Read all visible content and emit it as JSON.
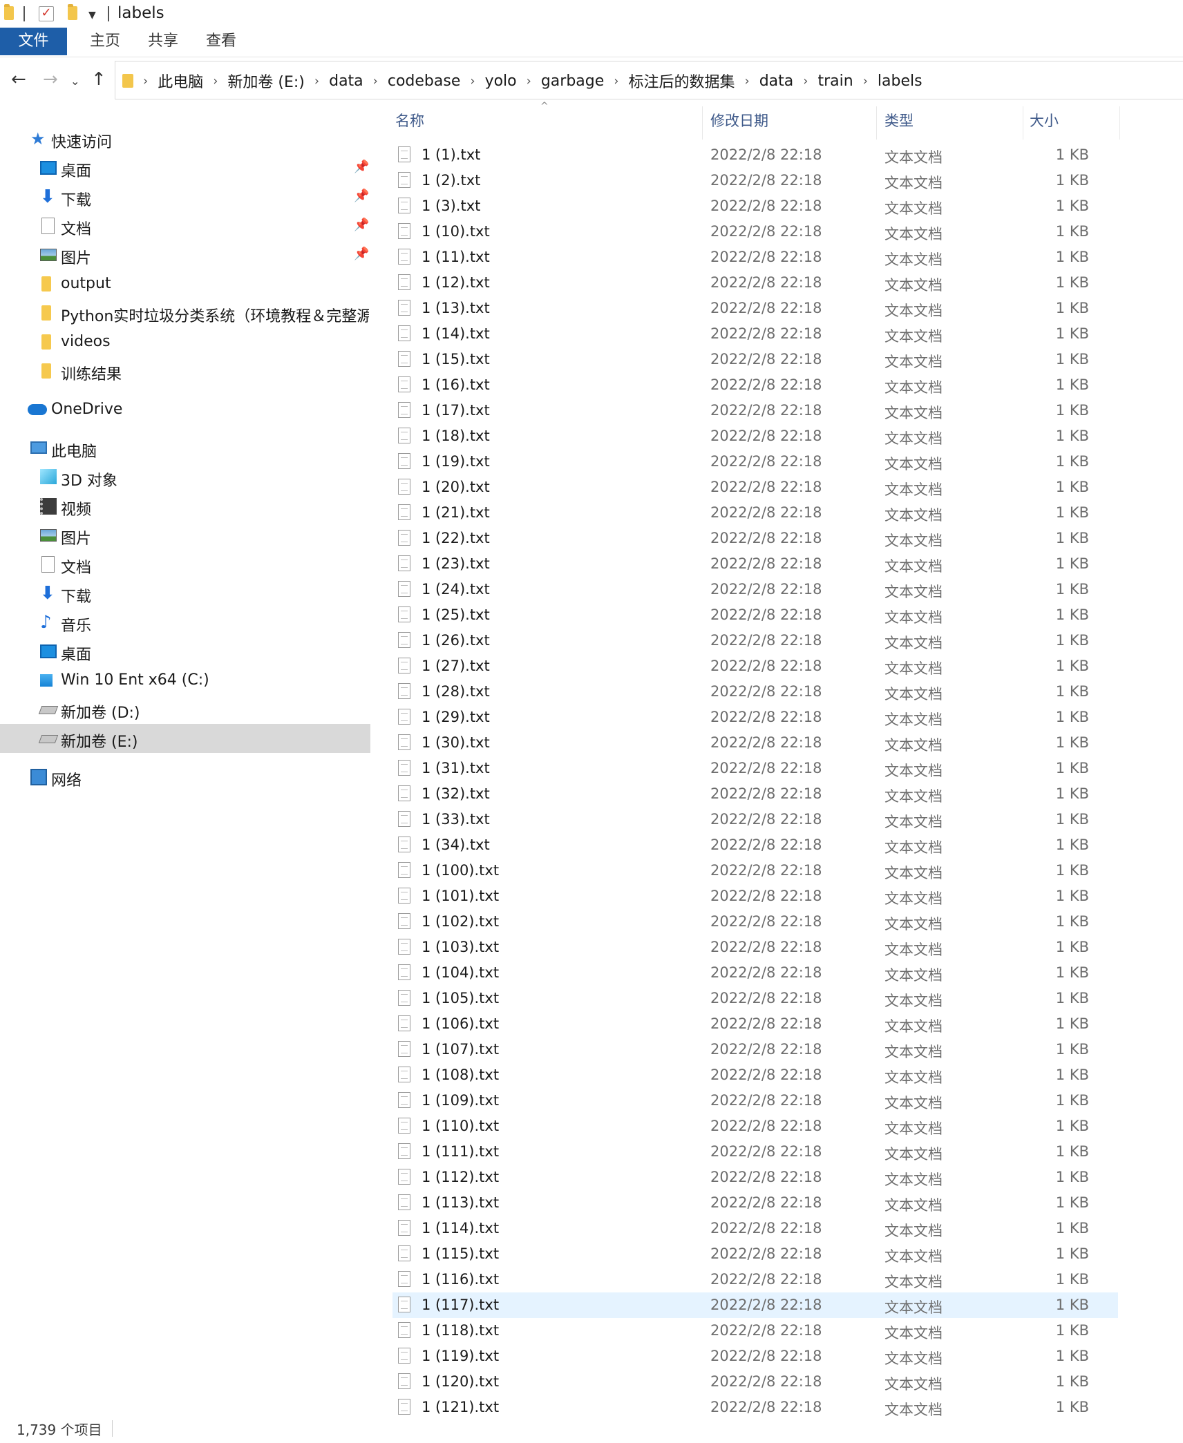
{
  "window": {
    "title": "labels"
  },
  "ribbon": {
    "tabs": [
      "文件",
      "主页",
      "共享",
      "查看"
    ]
  },
  "address": {
    "crumbs": [
      "此电脑",
      "新加卷 (E:)",
      "data",
      "codebase",
      "yolo",
      "garbage",
      "标注后的数据集",
      "data",
      "train",
      "labels"
    ]
  },
  "sidebar": {
    "quick_access": "快速访问",
    "quick_items": [
      "桌面",
      "下载",
      "文档",
      "图片",
      "output",
      "Python实时垃圾分类系统（环境教程＆完整源码",
      "videos",
      "训练结果"
    ],
    "onedrive": "OneDrive",
    "this_pc": "此电脑",
    "pc_items": [
      "3D 对象",
      "视频",
      "图片",
      "文档",
      "下载",
      "音乐",
      "桌面",
      "Win 10 Ent x64 (C:)",
      "新加卷 (D:)",
      "新加卷 (E:)"
    ],
    "network": "网络"
  },
  "columns": {
    "name": "名称",
    "date": "修改日期",
    "type": "类型",
    "size": "大小"
  },
  "common": {
    "date": "2022/2/8 22:18",
    "type": "文本文档",
    "size": "1 KB"
  },
  "files": [
    "1 (1).txt",
    "1 (2).txt",
    "1 (3).txt",
    "1 (10).txt",
    "1 (11).txt",
    "1 (12).txt",
    "1 (13).txt",
    "1 (14).txt",
    "1 (15).txt",
    "1 (16).txt",
    "1 (17).txt",
    "1 (18).txt",
    "1 (19).txt",
    "1 (20).txt",
    "1 (21).txt",
    "1 (22).txt",
    "1 (23).txt",
    "1 (24).txt",
    "1 (25).txt",
    "1 (26).txt",
    "1 (27).txt",
    "1 (28).txt",
    "1 (29).txt",
    "1 (30).txt",
    "1 (31).txt",
    "1 (32).txt",
    "1 (33).txt",
    "1 (34).txt",
    "1 (100).txt",
    "1 (101).txt",
    "1 (102).txt",
    "1 (103).txt",
    "1 (104).txt",
    "1 (105).txt",
    "1 (106).txt",
    "1 (107).txt",
    "1 (108).txt",
    "1 (109).txt",
    "1 (110).txt",
    "1 (111).txt",
    "1 (112).txt",
    "1 (113).txt",
    "1 (114).txt",
    "1 (115).txt",
    "1 (116).txt",
    "1 (117).txt",
    "1 (118).txt",
    "1 (119).txt",
    "1 (120).txt",
    "1 (121).txt"
  ],
  "hovered_file": "1 (117).txt",
  "status": {
    "count": "1,739 个项目"
  },
  "colors": {
    "accent": "#1e5ea8",
    "hover_row": "#e5f3ff",
    "selected_nav": "#d9d9d9",
    "header_text": "#3f5a8a"
  }
}
